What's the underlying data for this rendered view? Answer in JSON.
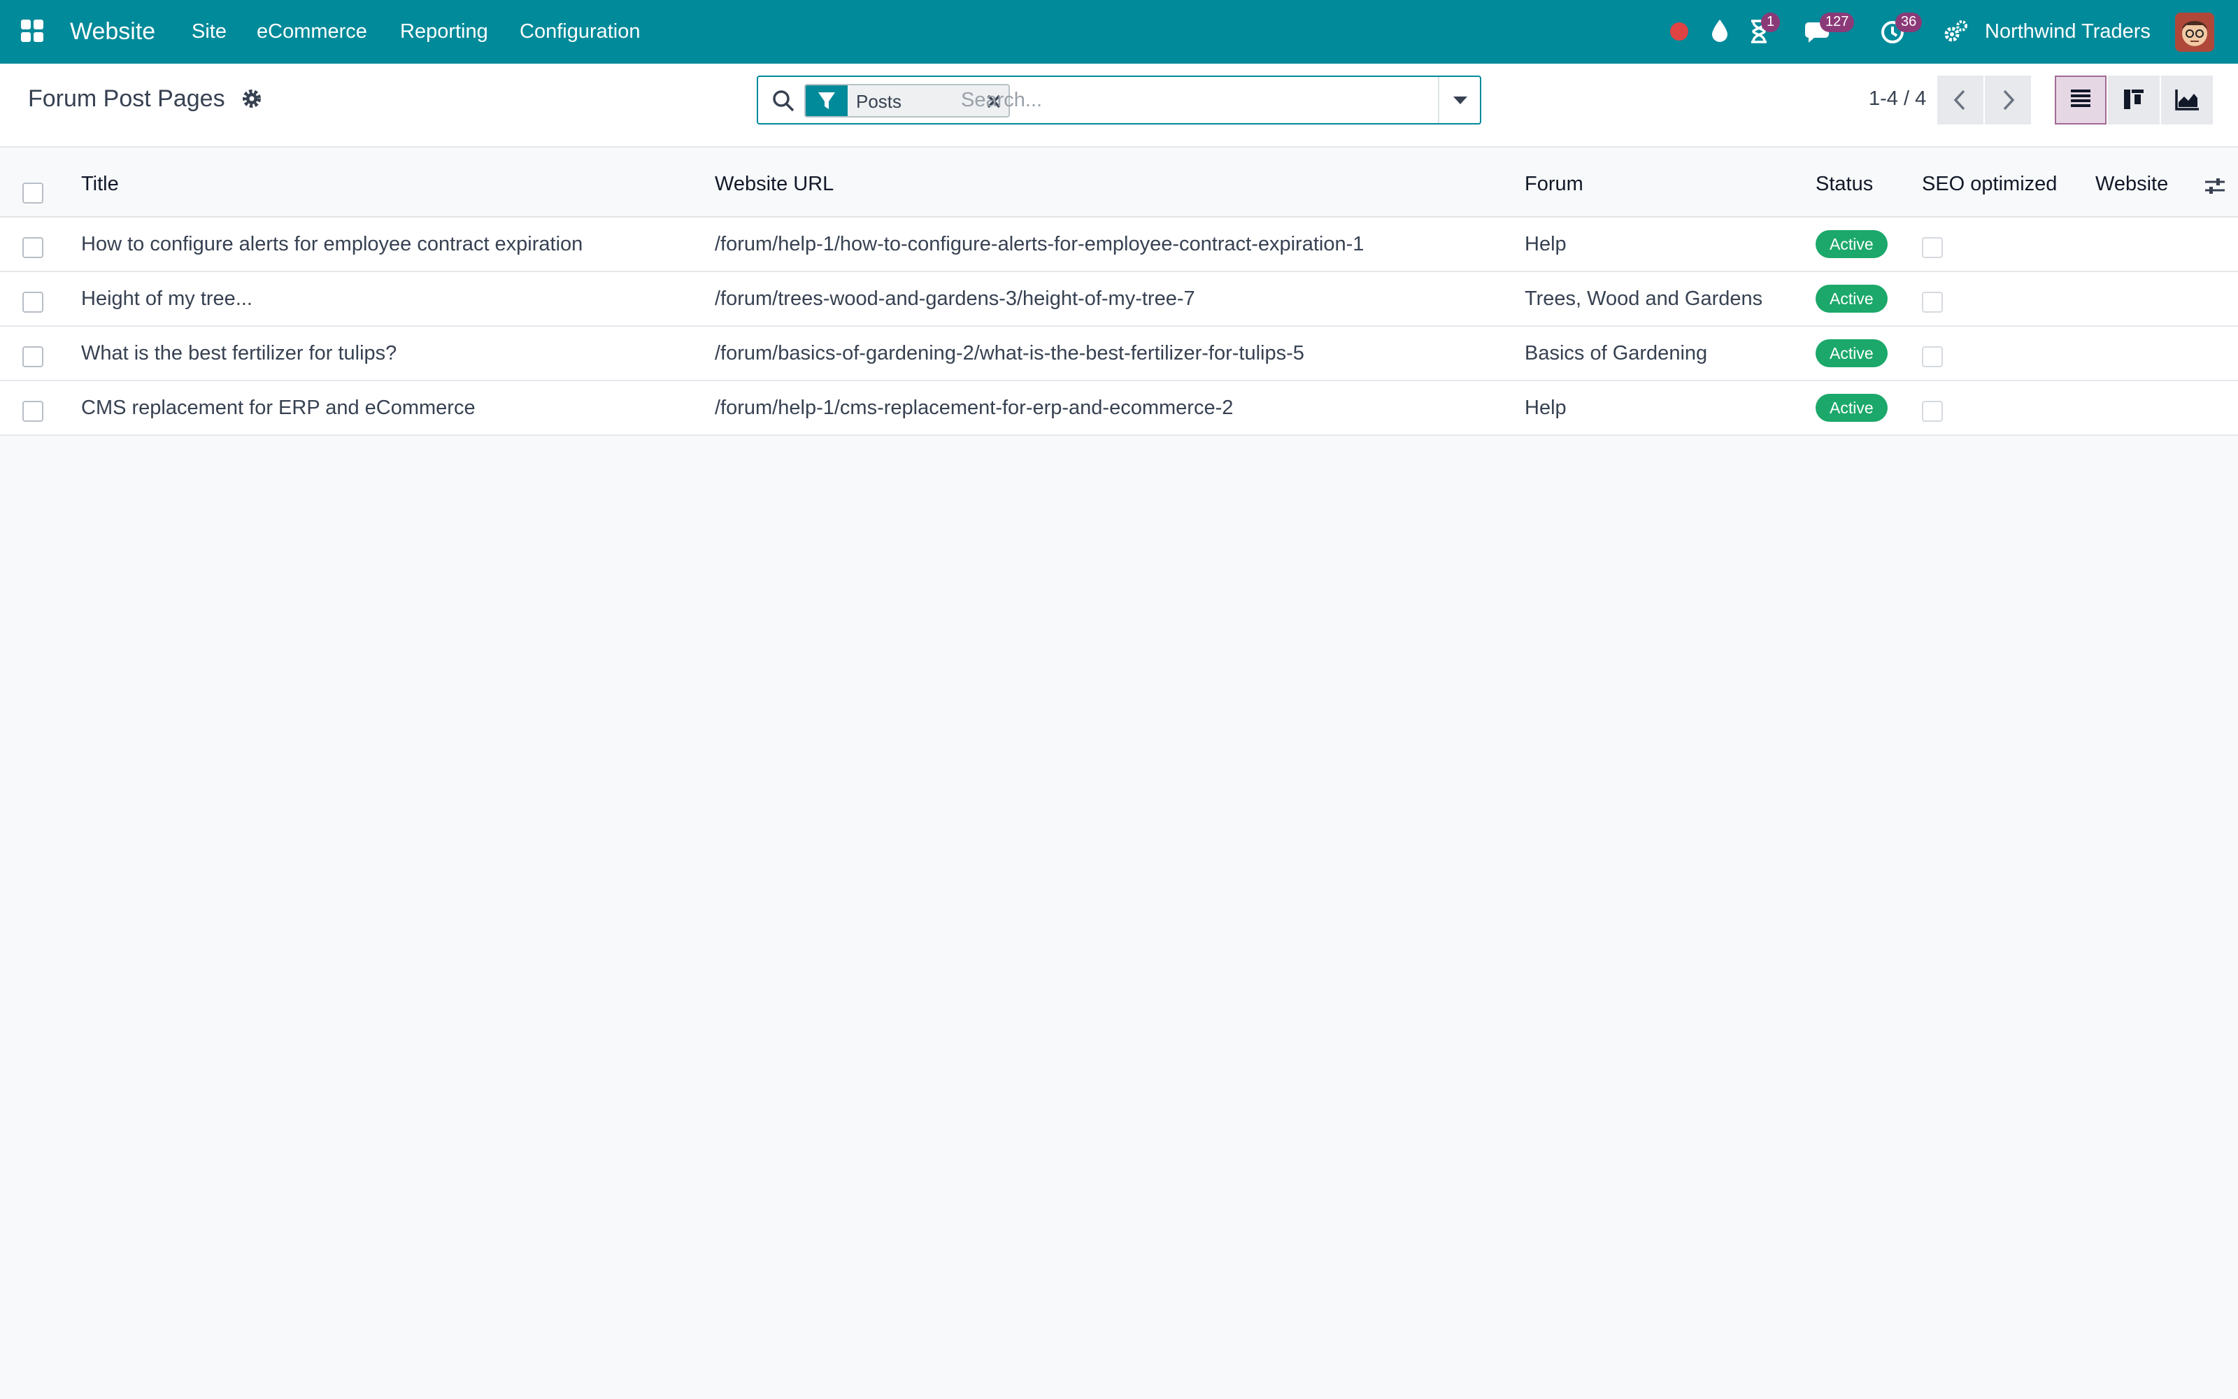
{
  "navbar": {
    "app_name": "Website",
    "menus": [
      "Site",
      "eCommerce",
      "Reporting",
      "Configuration"
    ],
    "badges": {
      "activities_timer": "1",
      "messages": "127",
      "activities": "36"
    },
    "company": "Northwind Traders",
    "colors": {
      "bar": "#018a9a",
      "badge": "#8b3a78",
      "record_dot": "#e04343"
    }
  },
  "control_panel": {
    "title": "Forum Post Pages",
    "facet": {
      "label": "Posts"
    },
    "search_placeholder": "Search...",
    "pager": "1-4 / 4",
    "views": [
      "list-view",
      "kanban-view",
      "graph-view"
    ],
    "active_view": "list-view"
  },
  "table": {
    "columns": [
      "Title",
      "Website URL",
      "Forum",
      "Status",
      "SEO optimized",
      "Website"
    ],
    "rows": [
      {
        "title": "How to configure alerts for employee contract expiration",
        "url": "/forum/help-1/how-to-configure-alerts-for-employee-contract-expiration-1",
        "forum": "Help",
        "status": "Active",
        "seo_optimized": false,
        "website": ""
      },
      {
        "title": "Height of my tree...",
        "url": "/forum/trees-wood-and-gardens-3/height-of-my-tree-7",
        "forum": "Trees, Wood and Gardens",
        "status": "Active",
        "seo_optimized": false,
        "website": ""
      },
      {
        "title": "What is the best fertilizer for tulips?",
        "url": "/forum/basics-of-gardening-2/what-is-the-best-fertilizer-for-tulips-5",
        "forum": "Basics of Gardening",
        "status": "Active",
        "seo_optimized": false,
        "website": ""
      },
      {
        "title": "CMS replacement for ERP and eCommerce",
        "url": "/forum/help-1/cms-replacement-for-erp-and-ecommerce-2",
        "forum": "Help",
        "status": "Active",
        "seo_optimized": false,
        "website": ""
      }
    ],
    "status_color": "#1ba86a"
  }
}
